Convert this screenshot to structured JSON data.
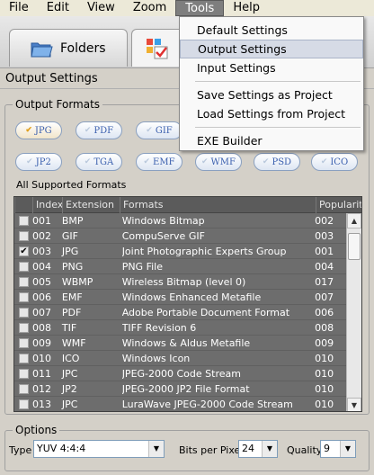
{
  "menubar": {
    "items": [
      "File",
      "Edit",
      "View",
      "Zoom",
      "Tools",
      "Help"
    ],
    "active_index": 4
  },
  "tabs": {
    "folders_label": "Folders"
  },
  "section_title": "Output Settings",
  "output_formats": {
    "label": "Output Formats",
    "row1": [
      {
        "label": "JPG",
        "selected": true
      },
      {
        "label": "PDF",
        "selected": false
      },
      {
        "label": "GIF",
        "selected": false
      }
    ],
    "row2": [
      {
        "label": "JP2",
        "selected": false
      },
      {
        "label": "TGA",
        "selected": false
      },
      {
        "label": "EMF",
        "selected": false
      },
      {
        "label": "WMF",
        "selected": false
      },
      {
        "label": "PSD",
        "selected": false
      },
      {
        "label": "ICO",
        "selected": false
      }
    ]
  },
  "all_formats_label": "All Supported Formats",
  "table": {
    "headers": [
      "Index",
      "Extension",
      "Formats",
      "Popularity"
    ],
    "rows": [
      {
        "checked": false,
        "index": "001",
        "ext": "BMP",
        "format": "Windows Bitmap",
        "popularity": "002"
      },
      {
        "checked": false,
        "index": "002",
        "ext": "GIF",
        "format": "CompuServe GIF",
        "popularity": "003"
      },
      {
        "checked": true,
        "index": "003",
        "ext": "JPG",
        "format": "Joint Photographic Experts Group",
        "popularity": "001"
      },
      {
        "checked": false,
        "index": "004",
        "ext": "PNG",
        "format": "PNG File",
        "popularity": "004"
      },
      {
        "checked": false,
        "index": "005",
        "ext": "WBMP",
        "format": "Wireless Bitmap (level 0)",
        "popularity": "017"
      },
      {
        "checked": false,
        "index": "006",
        "ext": "EMF",
        "format": "Windows Enhanced Metafile",
        "popularity": "007"
      },
      {
        "checked": false,
        "index": "007",
        "ext": "PDF",
        "format": "Adobe Portable Document Format",
        "popularity": "006"
      },
      {
        "checked": false,
        "index": "008",
        "ext": "TIF",
        "format": "TIFF Revision 6",
        "popularity": "008"
      },
      {
        "checked": false,
        "index": "009",
        "ext": "WMF",
        "format": "Windows & Aldus Metafile",
        "popularity": "009"
      },
      {
        "checked": false,
        "index": "010",
        "ext": "ICO",
        "format": "Windows Icon",
        "popularity": "010"
      },
      {
        "checked": false,
        "index": "011",
        "ext": "JPC",
        "format": "JPEG-2000 Code Stream",
        "popularity": "010"
      },
      {
        "checked": false,
        "index": "012",
        "ext": "JP2",
        "format": "JPEG-2000 JP2 File Format",
        "popularity": "010"
      },
      {
        "checked": false,
        "index": "013",
        "ext": "JPC",
        "format": "LuraWave JPEG-2000 Code Stream",
        "popularity": "010"
      }
    ]
  },
  "options": {
    "label": "Options",
    "type_label": "Type",
    "type_value": "YUV 4:4:4",
    "bpp_label": "Bits per Pixel",
    "bpp_value": "24",
    "quality_label": "Quality",
    "quality_value": "9"
  },
  "tools_menu": {
    "items": [
      "Default Settings",
      "Output Settings",
      "Input Settings"
    ],
    "items2": [
      "Save Settings as Project",
      "Load Settings from Project"
    ],
    "items3": [
      "EXE Builder"
    ]
  }
}
